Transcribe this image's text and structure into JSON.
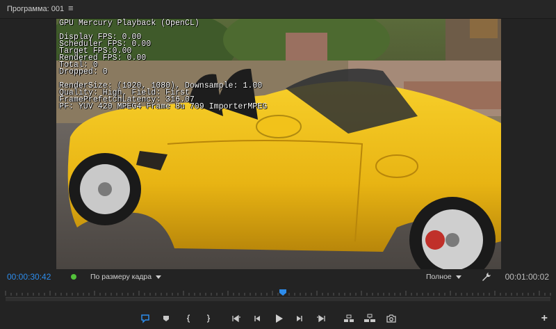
{
  "panel": {
    "title": "Программа: 001",
    "menu_icon": "hamburger-icon"
  },
  "overlay_lines": [
    "GPU Mercury Playback (OpenCL)",
    "",
    "Display FPS: 0.00",
    "Scheduler FPS: 0.00",
    "Target FPS:0.00",
    "Rendered FPS: 0.00",
    "Total: 0",
    "Dropped: 0",
    "",
    "RenderSize: (1920, 1080), Downsample: 1.00",
    "Quality: High, Field: First",
    "FramePrefetchLatency: 316.07",
    "PF: YUV 420 MPEG4 Frame 8u 709 ImporterMPEG"
  ],
  "controls": {
    "current_timecode": "00:00:30:42",
    "duration_timecode": "00:01:00:02",
    "fit_label": "По размеру кадра",
    "quality_label": "Полное"
  },
  "colors": {
    "accent": "#2d8ceb",
    "car_yellow": "#f2c21a",
    "status_green": "#53c23b"
  },
  "transport_icons": [
    "comment-marker-icon",
    "add-marker-icon",
    "mark-in-icon",
    "mark-out-icon",
    "go-to-in-icon",
    "step-back-icon",
    "play-icon",
    "step-forward-icon",
    "go-to-out-icon",
    "lift-icon",
    "extract-icon",
    "export-frame-icon"
  ],
  "add_button_icon": "plus-icon"
}
